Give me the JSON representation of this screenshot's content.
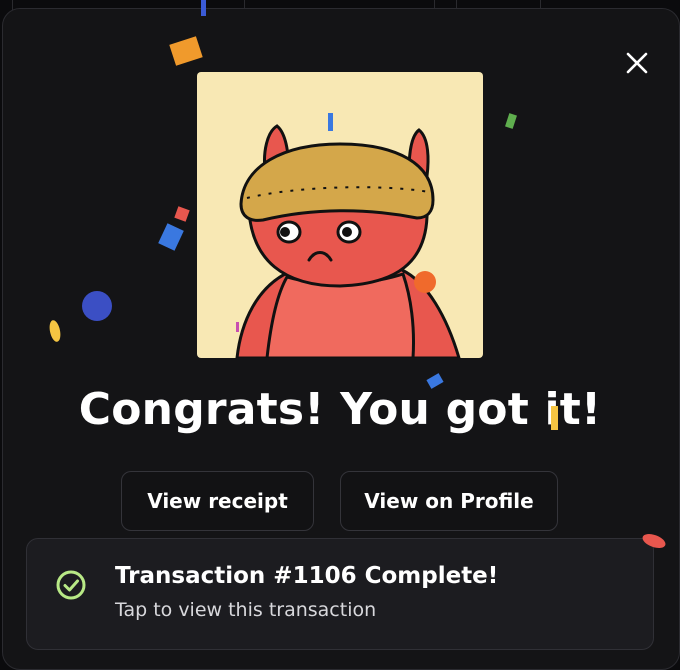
{
  "modal": {
    "title": "Congrats! You got it!",
    "buttons": {
      "receipt": "View receipt",
      "profile": "View on Profile"
    }
  },
  "toast": {
    "title": "Transaction #1106 Complete!",
    "subtitle": "Tap to view this transaction"
  },
  "icons": {
    "close": "close-icon",
    "success": "check-circle-icon"
  },
  "colors": {
    "success": "#b8e986",
    "art_background": "#f8e8b4",
    "character": "#e8574e",
    "beanie": "#d4a74a"
  }
}
